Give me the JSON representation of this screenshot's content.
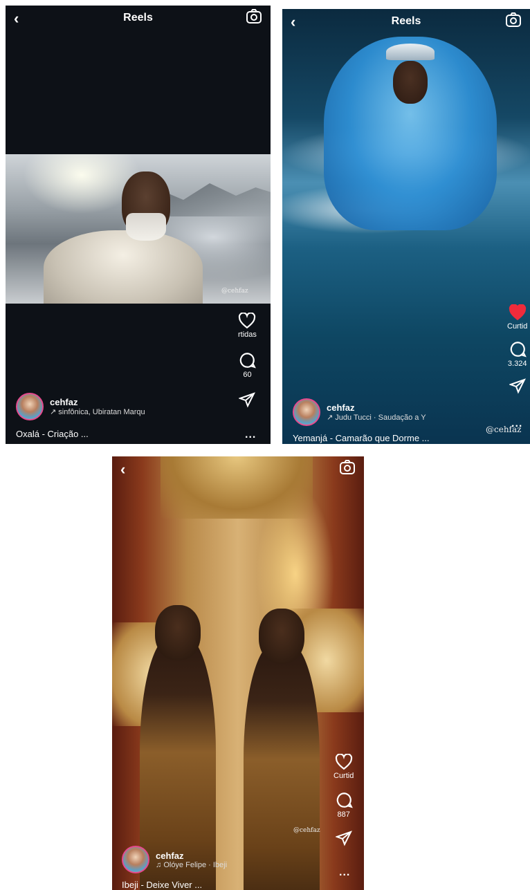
{
  "reels": [
    {
      "header_title": "Reels",
      "username": "cehfaz",
      "audio": "sinfônica, Ubiratan Marqu",
      "caption": "Oxalá - Criação ...",
      "likes_label": "rtidas",
      "comments": "60",
      "watermark": "@cehfaz",
      "more": "..."
    },
    {
      "header_title": "Reels",
      "username": "cehfaz",
      "audio": "Judu Tucci · Saudação a Y",
      "caption": "Yemanjá - Camarão que Dorme ...",
      "likes_label": "Curtid",
      "comments": "3.324",
      "watermark": "@cehfaz",
      "more": "..."
    },
    {
      "header_title": "",
      "username": "cehfaz",
      "audio": "Olóye Felipe · Ibeji",
      "caption": "Ibeji - Deixe Viver ...",
      "likes_label": "Curtid",
      "comments": "887",
      "watermark": "@cehfaz",
      "more": "..."
    }
  ],
  "icons": {
    "back": "‹",
    "audio_arrow": "↗",
    "audio_note": "♫"
  },
  "colors": {
    "liked_heart": "#ef2b3b",
    "avatar_ring": "#e64a8d"
  }
}
